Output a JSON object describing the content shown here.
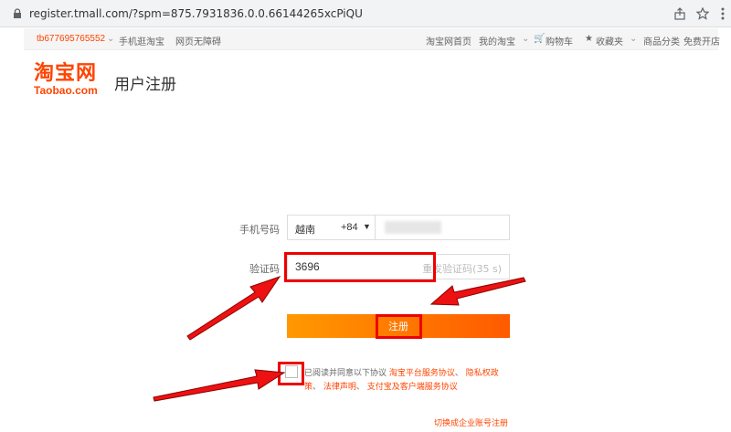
{
  "browser": {
    "url": "register.tmall.com/?spm=875.7931836.0.0.66144265xcPiQU"
  },
  "topbar": {
    "username": "tb677695765552",
    "left_links": [
      "手机逛淘宝",
      "网页无障碍"
    ],
    "right_links": [
      "淘宝网首页",
      "我的淘宝",
      "购物车",
      "收藏夹",
      "商品分类",
      "免费开店"
    ]
  },
  "header": {
    "logo_cn": "淘宝网",
    "logo_en": "Taobao.com",
    "heading": "用户注册"
  },
  "form": {
    "phone_label": "手机号码",
    "country_name": "越南",
    "country_code": "+84",
    "code_label": "验证码",
    "code_value": "3696",
    "resend_label": "重发验证码(35 s)",
    "register_label": "注册",
    "agree_prefix": "已阅读并同意以下协议",
    "agree_links": [
      "淘宝平台服务协议",
      "隐私权政策",
      "法律声明",
      "支付宝及客户端服务协议"
    ],
    "switch_link": "切换成企业账号注册"
  },
  "colors": {
    "brand": "#ff4400",
    "button_start": "#ff9900",
    "button_end": "#ff5a00",
    "annotation": "#ee0000"
  }
}
